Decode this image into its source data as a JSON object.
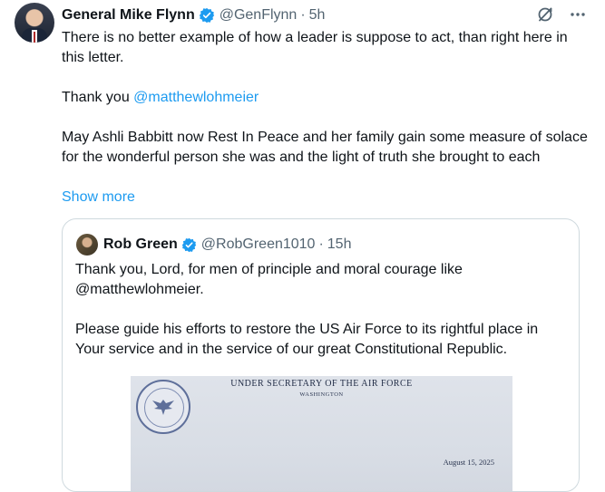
{
  "tweet": {
    "author_name": "General Mike Flynn",
    "handle": "@GenFlynn",
    "separator": "·",
    "time": "5h",
    "line1": "There is no better example of how a leader is suppose to act, than right here in this letter.",
    "thanks_prefix": "Thank you ",
    "mention": "@matthewlohmeier",
    "line3": "May Ashli Babbitt now Rest In Peace and her family gain some measure of solace for the wonderful person she was and the light of truth she brought to each",
    "show_more": "Show more",
    "icons": [
      "grok-icon",
      "more-icon"
    ]
  },
  "quote": {
    "author_name": "Rob Green",
    "handle": "@RobGreen1010",
    "separator": "·",
    "time": "15h",
    "para1": "Thank you, Lord, for men of principle and moral courage like @matthewlohmeier.",
    "para2": "Please guide his efforts to restore the US Air Force to its rightful place in Your service and in the service of our great Constitutional Republic.",
    "letter": {
      "title": "UNDER SECRETARY OF THE AIR FORCE",
      "subtitle": "WASHINGTON",
      "date": "August 15, 2025"
    }
  },
  "colors": {
    "text": "#0f1419",
    "secondary": "#536471",
    "link": "#1d9bf0",
    "verified": "#1d9bf0",
    "border": "#cfd9de"
  }
}
